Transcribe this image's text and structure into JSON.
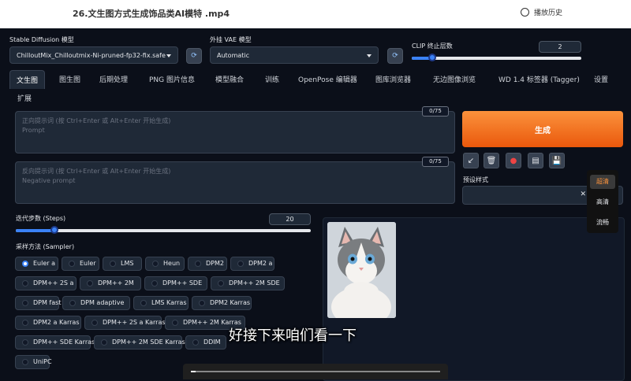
{
  "video_header": {
    "title": "26.文生图方式生成饰品类AI模特 .mp4",
    "history_label": "播放历史"
  },
  "model_section": {
    "label": "Stable Diffusion 模型",
    "value": "ChilloutMix_Chilloutmix-Ni-pruned-fp32-fix.safe"
  },
  "vae_section": {
    "label": "外挂 VAE 模型",
    "value": "Automatic"
  },
  "clip_section": {
    "label": "CLIP 终止层数",
    "value": "2",
    "fraction": 0.12
  },
  "tabs": [
    "文生图",
    "图生图",
    "后期处理",
    "PNG 图片信息",
    "模型融合",
    "训练",
    "OpenPose 编辑器",
    "图库浏览器",
    "无边图像浏览",
    "WD 1.4 标签器 (Tagger)",
    "设置",
    "扩展"
  ],
  "prompt": {
    "placeholder": "正向提示词 (按 Ctrl+Enter 或 Alt+Enter 开始生成)",
    "sub": "Prompt",
    "counter": "0/75"
  },
  "negative_prompt": {
    "placeholder": "反向提示词 (按 Ctrl+Enter 或 Alt+Enter 开始生成)",
    "sub": "Negative prompt",
    "counter": "0/75"
  },
  "generate_label": "生成",
  "preset_label": "预设样式",
  "steps": {
    "label": "迭代步数 (Steps)",
    "value": "20",
    "fraction": 0.13
  },
  "sampler": {
    "label": "采样方法 (Sampler)",
    "selected": "Euler a",
    "options": [
      "Euler a",
      "Euler",
      "LMS",
      "Heun",
      "DPM2",
      "DPM2 a",
      "DPM++ 2S a",
      "DPM++ 2M",
      "DPM++ SDE",
      "DPM++ 2M SDE",
      "DPM fast",
      "DPM adaptive",
      "LMS Karras",
      "DPM2 Karras",
      "DPM2 a Karras",
      "DPM++ 2S a Karras",
      "DPM++ 2M Karras",
      "DPM++ SDE Karras",
      "DPM++ 2M SDE Karras",
      "DDIM",
      "UniPC"
    ]
  },
  "quality_menu": [
    "超清",
    "高清",
    "流畅"
  ],
  "subtitle": "好接下来咱们看一下",
  "playback": {
    "progress": 0.02
  },
  "colors": {
    "accent": "#3b82f6",
    "generate": "#f97316",
    "background": "#0b0f19"
  }
}
